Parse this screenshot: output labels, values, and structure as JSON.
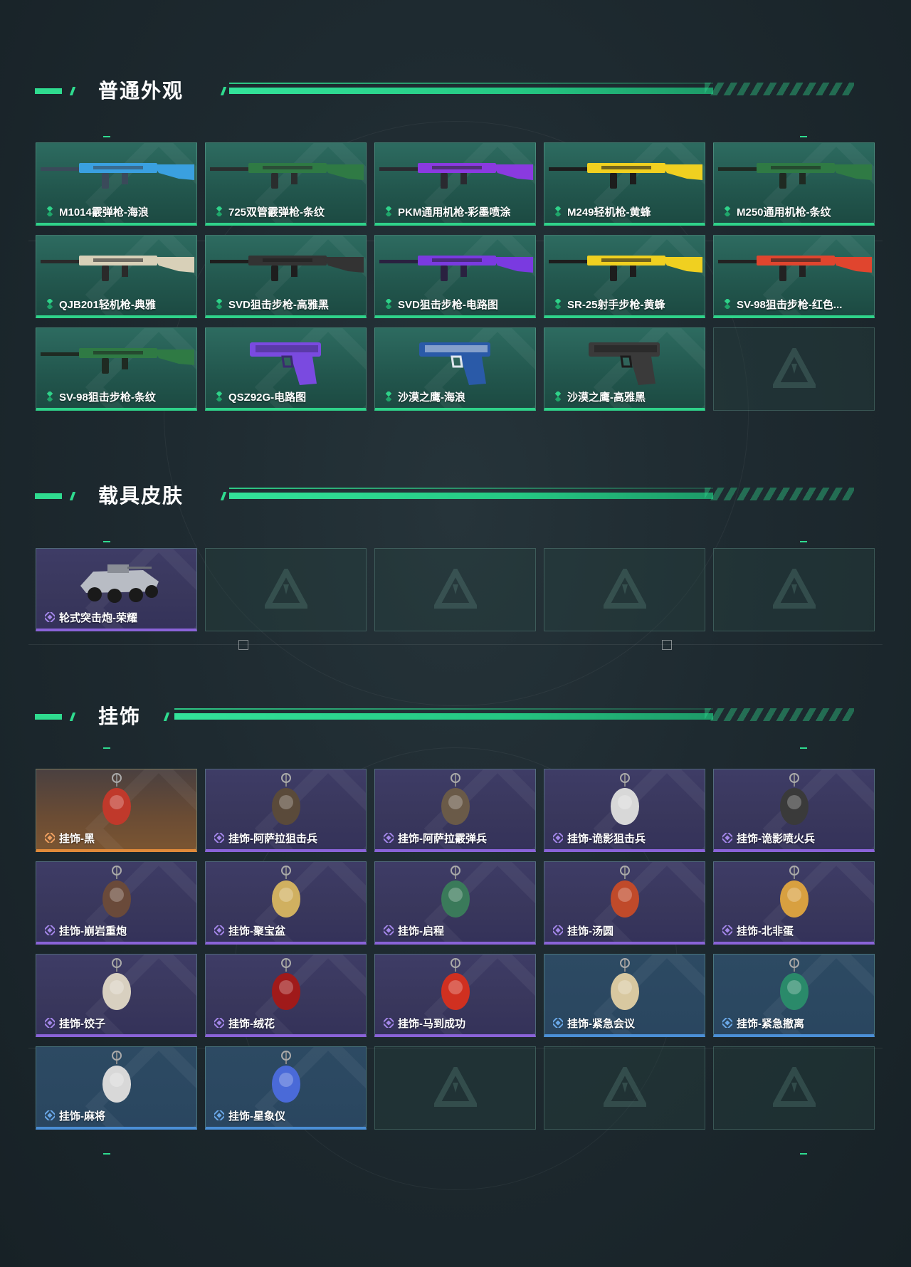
{
  "sections": {
    "weapons": {
      "title": "普通外观",
      "items": [
        {
          "name": "M1014霰弹枪-海浪"
        },
        {
          "name": "725双管霰弹枪-条纹"
        },
        {
          "name": "PKM通用机枪-彩墨喷涂"
        },
        {
          "name": "M249轻机枪-黄蜂"
        },
        {
          "name": "M250通用机枪-条纹"
        },
        {
          "name": "QJB201轻机枪-典雅"
        },
        {
          "name": "SVD狙击步枪-高雅黑"
        },
        {
          "name": "SVD狙击步枪-电路图"
        },
        {
          "name": "SR-25射手步枪-黄蜂"
        },
        {
          "name": "SV-98狙击步枪-红色..."
        },
        {
          "name": "SV-98狙击步枪-条纹"
        },
        {
          "name": "QSZ92G-电路图"
        },
        {
          "name": "沙漠之鹰-海浪"
        },
        {
          "name": "沙漠之鹰-高雅黑"
        }
      ]
    },
    "vehicles": {
      "title": "载具皮肤",
      "items": [
        {
          "name": "轮式突击炮-荣耀"
        }
      ]
    },
    "charms": {
      "title": "挂饰",
      "items": [
        {
          "name": "挂饰-黑"
        },
        {
          "name": "挂饰-阿萨拉狙击兵"
        },
        {
          "name": "挂饰-阿萨拉霰弹兵"
        },
        {
          "name": "挂饰-诡影狙击兵"
        },
        {
          "name": "挂饰-诡影喷火兵"
        },
        {
          "name": "挂饰-崩岩重炮"
        },
        {
          "name": "挂饰-聚宝盆"
        },
        {
          "name": "挂饰-启程"
        },
        {
          "name": "挂饰-汤圆"
        },
        {
          "name": "挂饰-北非蛋"
        },
        {
          "name": "挂饰-饺子"
        },
        {
          "name": "挂饰-绒花"
        },
        {
          "name": "挂饰-马到成功"
        },
        {
          "name": "挂饰-紧急会议"
        },
        {
          "name": "挂饰-紧急撤离"
        },
        {
          "name": "挂饰-麻将"
        },
        {
          "name": "挂饰-星象仪"
        }
      ]
    }
  },
  "colors": {
    "accent": "#2fdb8f",
    "green_rarity": "#2fd38a",
    "purple_rarity": "#8a63d8",
    "orange_rarity": "#e08a3a",
    "blue_rarity": "#4b8fd6"
  }
}
